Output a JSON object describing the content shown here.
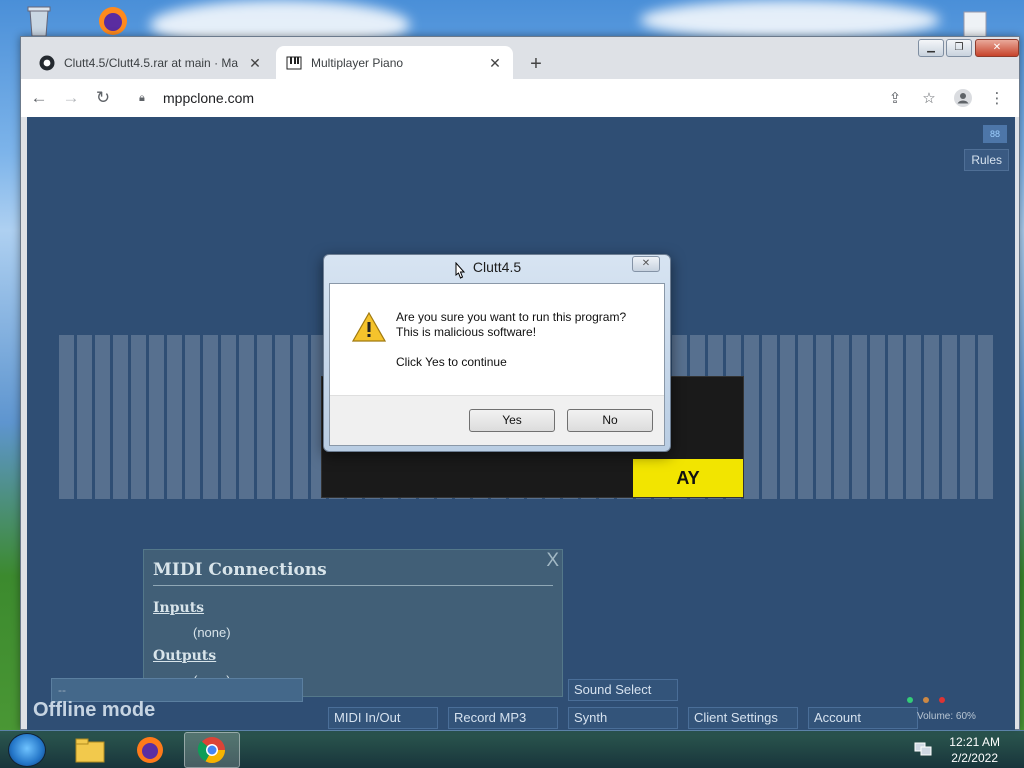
{
  "browser": {
    "tabs": [
      {
        "title": "Clutt4.5/Clutt4.5.rar at main · Ma",
        "active": false,
        "icon": "github-icon"
      },
      {
        "title": "Multiplayer Piano",
        "active": true,
        "icon": "piano-icon"
      }
    ],
    "url": "mppclone.com"
  },
  "page": {
    "rules_label": "Rules",
    "badge": "88",
    "play_label": "AY",
    "select_value": "--",
    "offline_label": "Offline mode",
    "bottom_buttons": {
      "midi": "MIDI In/Out",
      "record": "Record MP3",
      "synth": "Synth",
      "sound_select": "Sound Select",
      "client_settings": "Client Settings",
      "account": "Account"
    },
    "volume": "Volume: 60%"
  },
  "dialog": {
    "title": "Clutt4.5",
    "line1": "Are you sure you want to run this program?",
    "line2": "This is malicious software!",
    "line3": "Click Yes to continue",
    "yes": "Yes",
    "no": "No"
  },
  "midi_panel": {
    "title": "MIDI Connections",
    "close": "X",
    "inputs_label": "Inputs",
    "inputs_value": "(none)",
    "outputs_label": "Outputs",
    "outputs_value": "(none)"
  },
  "taskbar": {
    "time": "12:21 AM",
    "date": "2/2/2022"
  },
  "colors": {
    "page_bg": "#2f4e74",
    "play_yellow": "#f2e500"
  }
}
